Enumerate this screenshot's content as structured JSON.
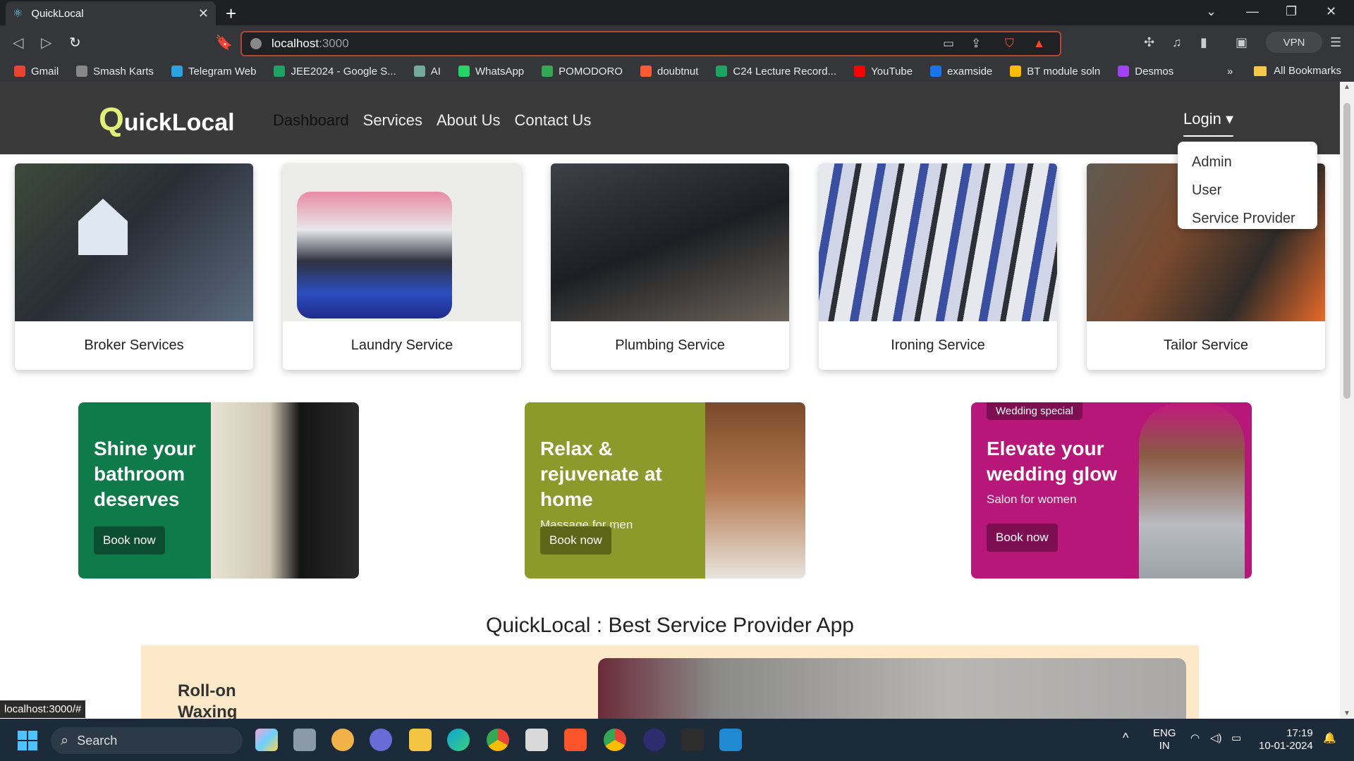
{
  "browser": {
    "tab_title": "QuickLocal",
    "url_host": "localhost",
    "url_port": ":3000",
    "vpn_label": "VPN",
    "bookmarks": [
      {
        "label": "Gmail",
        "color": "#ea4335"
      },
      {
        "label": "Smash Karts",
        "color": "#888888"
      },
      {
        "label": "Telegram Web",
        "color": "#2aa3e0"
      },
      {
        "label": "JEE2024 - Google S...",
        "color": "#1ea362"
      },
      {
        "label": "AI",
        "color": "#74aa9c"
      },
      {
        "label": "WhatsApp",
        "color": "#25d366"
      },
      {
        "label": "POMODORO",
        "color": "#34a853"
      },
      {
        "label": "doubtnut",
        "color": "#ff5a36"
      },
      {
        "label": "C24 Lecture Record...",
        "color": "#1ea362"
      },
      {
        "label": "YouTube",
        "color": "#ff0000"
      },
      {
        "label": "examside",
        "color": "#1a73e8"
      },
      {
        "label": "BT module soln",
        "color": "#fbbc04"
      },
      {
        "label": "Desmos",
        "color": "#a142f4"
      }
    ],
    "overflow": "»",
    "all_bookmarks": "All Bookmarks",
    "status_url": "localhost:3000/#"
  },
  "navbar": {
    "brand_first": "Q",
    "brand_rest": "uickLocal",
    "links": [
      "Dashboard",
      "Services",
      "About Us",
      "Contact Us"
    ],
    "login": "Login ▾",
    "dropdown": [
      "Admin",
      "User",
      "Service Provider"
    ]
  },
  "services": [
    {
      "label": "Broker Services"
    },
    {
      "label": "Laundry Service"
    },
    {
      "label": "Plumbing Service"
    },
    {
      "label": "Ironing Service"
    },
    {
      "label": "Tailor Service"
    }
  ],
  "banners": [
    {
      "badge": "",
      "title": "Shine your bathroom deserves",
      "sub": "",
      "button": "Book now",
      "bg": "#0f7a4a",
      "btn_bg": "#0b4d30"
    },
    {
      "badge": "",
      "title": "Relax & rejuvenate at home",
      "sub": "Massage for men",
      "button": "Book now",
      "bg": "#8b9a2a",
      "btn_bg": "#5b6618"
    },
    {
      "badge": "Wedding special",
      "title": "Elevate your wedding glow",
      "sub": "Salon for women",
      "button": "Book now",
      "bg": "#b8177a",
      "btn_bg": "#7e0e52"
    }
  ],
  "main_heading": "QuickLocal : Best Service Provider App",
  "promo": {
    "text": "Roll-on Waxing"
  },
  "taskbar": {
    "search": "Search",
    "lang_top": "ENG",
    "lang_bottom": "IN",
    "time": "17:19",
    "date": "10-01-2024"
  }
}
